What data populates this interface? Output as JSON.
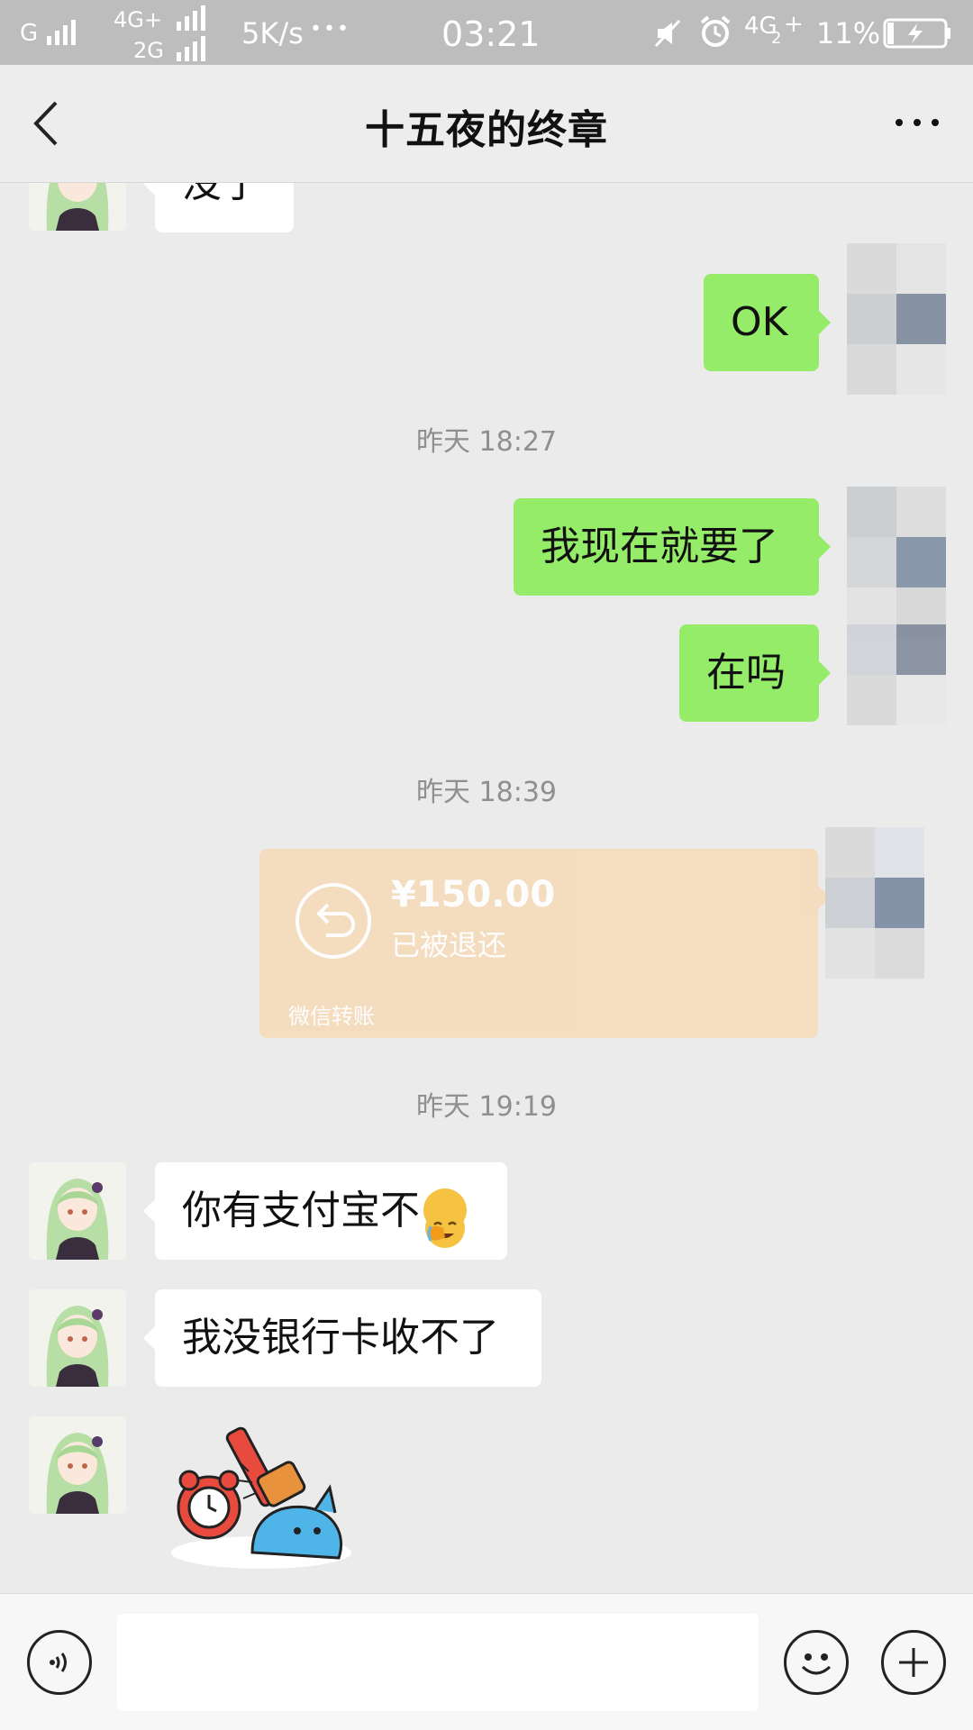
{
  "status_bar": {
    "carrier1": "G",
    "carrier2_top": "4G+",
    "carrier2_bottom": "2G",
    "speed": "5K/s",
    "more": "•••",
    "time": "03:21",
    "network": "4G",
    "network_sub": "2",
    "network_plus": "+",
    "battery": "11%",
    "icons": [
      "signal-icon",
      "mute-icon",
      "alarm-icon",
      "battery-charging-icon"
    ]
  },
  "header": {
    "title": "十五夜的终章",
    "back_icon": "chevron-left-icon",
    "more_icon": "more-dots-icon"
  },
  "messages": [
    {
      "side": "left",
      "text": "没了"
    },
    {
      "side": "right",
      "text": "OK"
    },
    {
      "timestamp": "昨天 18:27"
    },
    {
      "side": "right",
      "text": "我现在就要了"
    },
    {
      "side": "right",
      "text": "在吗"
    },
    {
      "timestamp": "昨天 18:39"
    },
    {
      "side": "right",
      "type": "transfer",
      "amount": "¥150.00",
      "status": "已被退还",
      "source": "微信转账"
    },
    {
      "timestamp": "昨天 19:19"
    },
    {
      "side": "left",
      "text": "你有支付宝不",
      "emoji": "facepalm-emoji"
    },
    {
      "side": "left",
      "text": "我没银行卡收不了"
    },
    {
      "side": "left",
      "type": "sticker",
      "sticker": "alarm-clock-hammer-sticker"
    }
  ],
  "input_bar": {
    "voice_icon": "voice-icon",
    "emoji_icon": "emoji-icon",
    "plus_icon": "plus-icon",
    "input_value": ""
  },
  "colors": {
    "chat_bg": "#ebebeb",
    "bubble_right": "#95ec69",
    "bubble_left": "#ffffff",
    "transfer_returned": "#f5dcbd",
    "status_bar": "#bdbdbd"
  }
}
